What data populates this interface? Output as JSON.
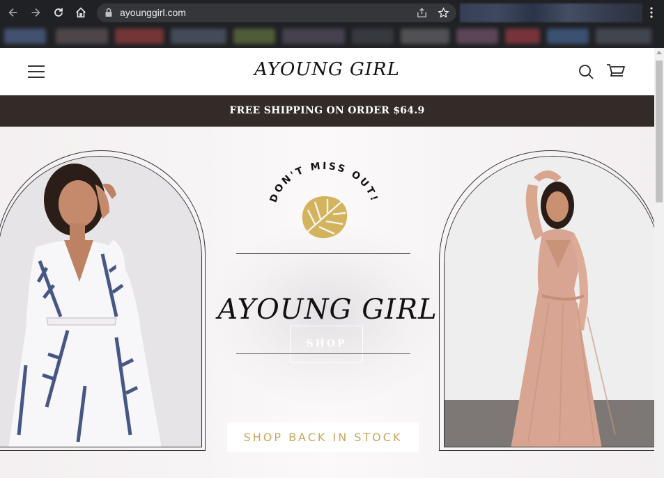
{
  "browser": {
    "url": "ayounggirl.com",
    "icons": [
      "back-icon",
      "forward-icon",
      "reload-icon",
      "home-icon",
      "lock-icon",
      "share-icon",
      "star-icon",
      "kebab-menu-icon"
    ]
  },
  "header": {
    "logo": "AYOUNG GIRL",
    "icons": [
      "hamburger-menu-icon",
      "search-icon",
      "cart-icon"
    ]
  },
  "announcement": {
    "text": "FREE SHIPPING ON ORDER $64.9"
  },
  "hero": {
    "tagline": "DON'T MISS OUT!",
    "brand": "AYOUNG GIRL",
    "shop_button": "SHOP",
    "cta_button": "SHOP BACK IN STOCK",
    "accent_color": "#c8a75b",
    "leaf_color": "#d3b45d"
  },
  "colors": {
    "announce_bg": "#322b28",
    "chrome_bg": "#202124"
  }
}
